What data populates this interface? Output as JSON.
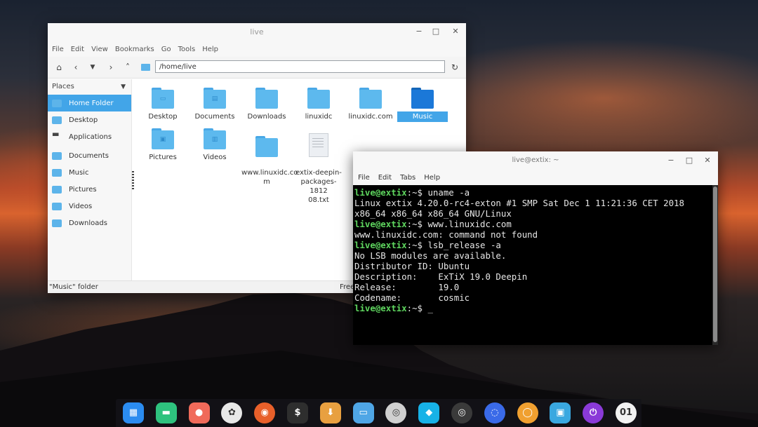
{
  "file_manager": {
    "title": "live",
    "menu": [
      "File",
      "Edit",
      "View",
      "Bookmarks",
      "Go",
      "Tools",
      "Help"
    ],
    "path": "/home/live",
    "sidebar_header": "Places",
    "sidebar_items": [
      "Home Folder",
      "Desktop",
      "Applications",
      "Documents",
      "Music",
      "Pictures",
      "Videos",
      "Downloads"
    ],
    "selected_sidebar": "Home Folder",
    "files_row1": [
      "Desktop",
      "Documents",
      "Downloads",
      "linuxidc",
      "linuxidc.com",
      "Music"
    ],
    "files_row2": [
      "Pictures",
      "Videos",
      "www.linuxidc.co\nm",
      "extix-deepin-\npackages-1812\n08.txt"
    ],
    "selected_file": "Music",
    "status": "\"Music\" folder",
    "status_free": "Free"
  },
  "terminal": {
    "title": "live@extix: ~",
    "menu": [
      "File",
      "Edit",
      "Tabs",
      "Help"
    ],
    "prompt": "live@extix",
    "lines": [
      {
        "prompt": true,
        "text": ":~$ uname -a"
      },
      {
        "prompt": false,
        "text": "Linux extix 4.20.0-rc4-exton #1 SMP Sat Dec 1 11:21:36 CET 2018"
      },
      {
        "prompt": false,
        "text": "x86_64 x86_64 x86_64 GNU/Linux"
      },
      {
        "prompt": true,
        "text": ":~$ www.linuxidc.com"
      },
      {
        "prompt": false,
        "text": "www.linuxidc.com: command not found"
      },
      {
        "prompt": true,
        "text": ":~$ lsb_release -a"
      },
      {
        "prompt": false,
        "text": "No LSB modules are available."
      },
      {
        "prompt": false,
        "text": "Distributor ID:\tUbuntu"
      },
      {
        "prompt": false,
        "text": "Description:\tExTiX 19.0 Deepin"
      },
      {
        "prompt": false,
        "text": "Release:\t19.0"
      },
      {
        "prompt": false,
        "text": "Codename:\tcosmic"
      },
      {
        "prompt": true,
        "text": ":~$ _"
      }
    ]
  },
  "dock": {
    "apps": [
      {
        "name": "launcher",
        "color": "#2b8cf0",
        "glyph": "▦"
      },
      {
        "name": "workspace",
        "color": "#2ec27e",
        "glyph": "▬"
      },
      {
        "name": "screen-recorder",
        "color": "#f06a5a",
        "glyph": "●"
      },
      {
        "name": "settings",
        "color": "#e8e8e8",
        "glyph": "✿"
      },
      {
        "name": "firefox",
        "color": "#e8602a",
        "glyph": "◉"
      },
      {
        "name": "terminal",
        "color": "#2e2e2e",
        "glyph": "$"
      },
      {
        "name": "downloader",
        "color": "#e8a040",
        "glyph": "⬇"
      },
      {
        "name": "file-manager",
        "color": "#4fa6e6",
        "glyph": "▭"
      },
      {
        "name": "disc",
        "color": "#d0d0d0",
        "glyph": "◎"
      },
      {
        "name": "kodi",
        "color": "#17b2e7",
        "glyph": "◆"
      },
      {
        "name": "camera",
        "color": "#3a3a3a",
        "glyph": "◎"
      },
      {
        "name": "screenshot",
        "color": "#3a6ae8",
        "glyph": "◌"
      },
      {
        "name": "music",
        "color": "#f0a030",
        "glyph": "◯"
      },
      {
        "name": "image-viewer",
        "color": "#3aa8e0",
        "glyph": "▣"
      },
      {
        "name": "shutdown",
        "color": "#8a3ad8",
        "glyph": "⏻"
      },
      {
        "name": "clock",
        "color": "#f2f2f2",
        "glyph": "01"
      }
    ]
  }
}
